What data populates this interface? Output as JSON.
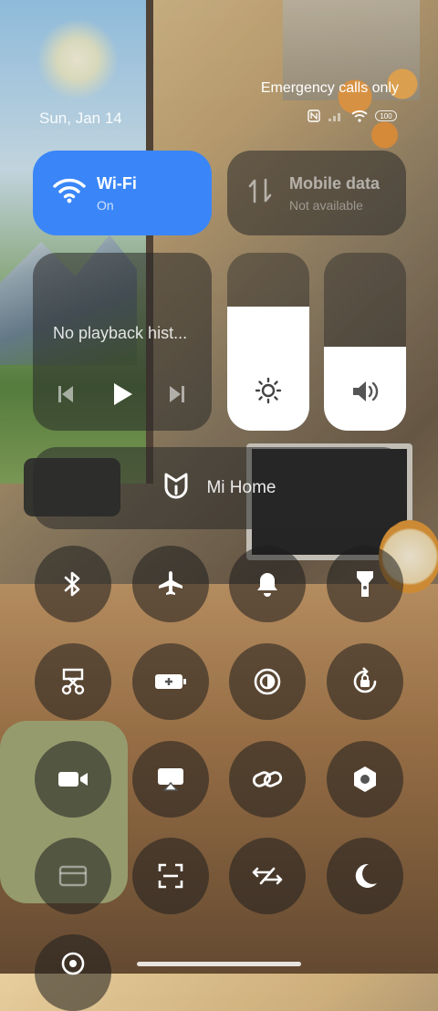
{
  "status": {
    "date": "Sun, Jan 14",
    "carrier": "Emergency calls only",
    "battery": "100"
  },
  "tiles": {
    "wifi": {
      "title": "Wi-Fi",
      "status": "On"
    },
    "mobile": {
      "title": "Mobile data",
      "status": "Not available"
    },
    "media": {
      "text": "No playback hist..."
    },
    "brightness": {
      "level": 0.7
    },
    "volume": {
      "level": 0.47
    },
    "mihome": {
      "label": "Mi Home"
    }
  },
  "toggles": [
    {
      "icon": "bluetooth-icon"
    },
    {
      "icon": "airplane-icon"
    },
    {
      "icon": "bell-icon"
    },
    {
      "icon": "flashlight-icon"
    },
    {
      "icon": "screenshot-icon"
    },
    {
      "icon": "battery-saver-icon"
    },
    {
      "icon": "dark-mode-icon"
    },
    {
      "icon": "rotation-lock-icon"
    },
    {
      "icon": "video-camera-icon"
    },
    {
      "icon": "cast-icon"
    },
    {
      "icon": "link-icon"
    },
    {
      "icon": "settings-hex-icon"
    },
    {
      "icon": "card-icon"
    },
    {
      "icon": "scanner-icon"
    },
    {
      "icon": "sync-icon"
    },
    {
      "icon": "moon-icon"
    },
    {
      "icon": "location-icon"
    }
  ],
  "colors": {
    "accent": "#3a86f8"
  }
}
